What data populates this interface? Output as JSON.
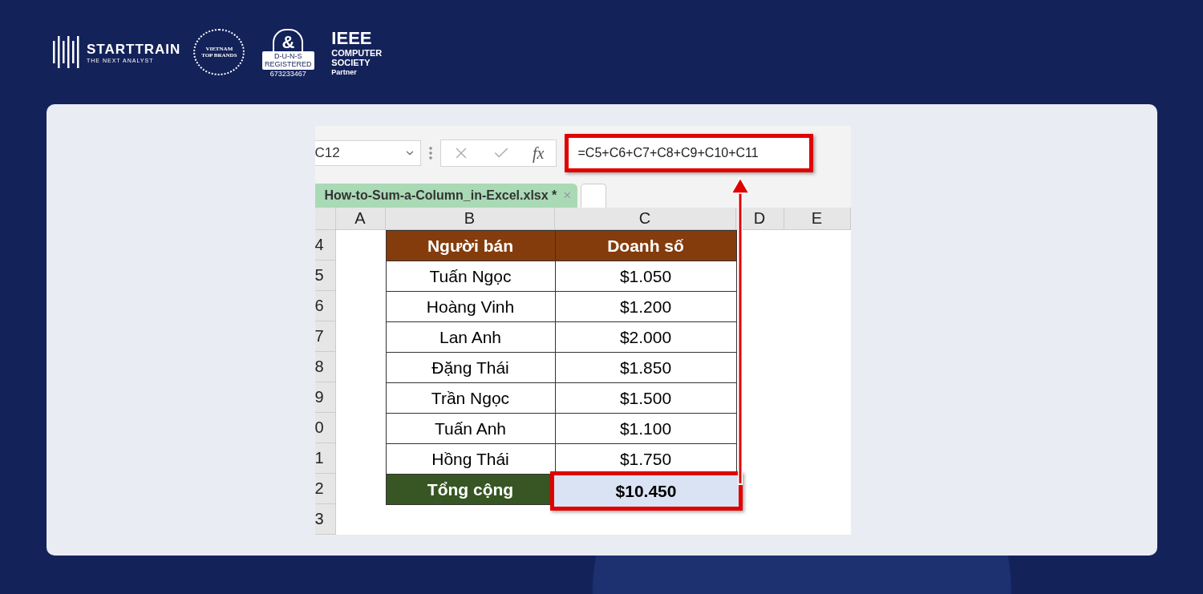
{
  "brand": {
    "name": "STARTTRAIN",
    "tagline": "THE NEXT ANALYST"
  },
  "badges": {
    "top_brands": [
      "VIETNAM",
      "TOP BRANDS"
    ],
    "duns": {
      "symbol": "&",
      "label": "D-U-N-S",
      "registered": "REGISTERED",
      "number": "673233467"
    },
    "ieee": {
      "title": "IEEE",
      "lines": [
        "COMPUTER",
        "SOCIETY"
      ],
      "role": "Partner"
    }
  },
  "excel": {
    "name_box": "C12",
    "function_label": "fx",
    "formula": "=C5+C6+C7+C8+C9+C10+C11",
    "tabs": [
      {
        "label": "How-to-Sum-a-Column_in-Excel.xlsx *",
        "close": "×",
        "selected": true
      }
    ],
    "columns": [
      "A",
      "B",
      "C",
      "D",
      "E"
    ],
    "rows": [
      {
        "number": "4",
        "kind": "header",
        "cells": [
          "",
          "Người bán",
          "Doanh số"
        ]
      },
      {
        "number": "5",
        "kind": "data",
        "cells": [
          "",
          "Tuấn Ngọc",
          "$1.050"
        ]
      },
      {
        "number": "6",
        "kind": "data",
        "cells": [
          "",
          "Hoàng Vinh",
          "$1.200"
        ]
      },
      {
        "number": "7",
        "kind": "data",
        "cells": [
          "",
          "Lan Anh",
          "$2.000"
        ]
      },
      {
        "number": "8",
        "kind": "data",
        "cells": [
          "",
          "Đặng Thái",
          "$1.850"
        ]
      },
      {
        "number": "9",
        "kind": "data",
        "cells": [
          "",
          "Trần Ngọc",
          "$1.500"
        ]
      },
      {
        "number": "0",
        "kind": "data",
        "cells": [
          "",
          "Tuấn Anh",
          "$1.100"
        ]
      },
      {
        "number": "1",
        "kind": "data",
        "cells": [
          "",
          "Hồng Thái",
          "$1.750"
        ]
      },
      {
        "number": "2",
        "kind": "total",
        "cells": [
          "",
          "Tổng cộng",
          "$10.450"
        ]
      },
      {
        "number": "3",
        "kind": "empty",
        "cells": []
      }
    ]
  }
}
